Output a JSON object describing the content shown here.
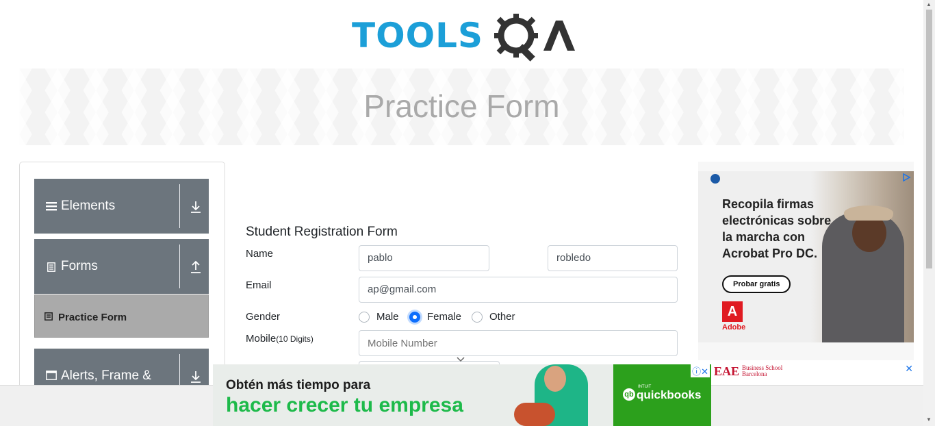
{
  "logo": {
    "text": "TOOLS",
    "suffix": "QA"
  },
  "banner": {
    "title": "Practice Form"
  },
  "sidebar": {
    "groups": [
      {
        "label": "Elements",
        "icon": "hamburger-icon",
        "arrow": "download-arrow-icon"
      },
      {
        "label": "Forms",
        "icon": "document-icon",
        "arrow": "upload-arrow-icon"
      },
      {
        "label": "Alerts, Frame &",
        "icon": "window-icon",
        "arrow": "download-arrow-icon"
      }
    ],
    "active_item": {
      "label": "Practice Form",
      "icon": "form-icon"
    }
  },
  "form": {
    "title": "Student Registration Form",
    "name_label": "Name",
    "first_name_value": "pablo",
    "last_name_value": "robledo",
    "email_label": "Email",
    "email_value": "ap@gmail.com",
    "gender_label": "Gender",
    "gender_options": [
      "Male",
      "Female",
      "Other"
    ],
    "gender_selected": "Female",
    "mobile_label": "Mobile",
    "mobile_hint": "(10 Digits)",
    "mobile_placeholder": "Mobile Number"
  },
  "ad_right": {
    "headline": "Recopila firmas electrónicas sobre la marcha con Acrobat Pro DC.",
    "cta": "Probar gratis",
    "brand": "Adobe",
    "eae_name": "EAE",
    "eae_sub_line1": "Business School",
    "eae_sub_line2": "Barcelona",
    "close": "✕"
  },
  "ad_bottom": {
    "line1": "Obtén más tiempo para",
    "line2": "hacer crecer tu empresa",
    "brand_small": "INTUIT",
    "brand": "quickbooks",
    "close": "ⓘ✕"
  },
  "colors": {
    "accent": "#1c9fd8",
    "sidebar_group": "#6c757d",
    "radio_selected": "#0d6efd"
  }
}
